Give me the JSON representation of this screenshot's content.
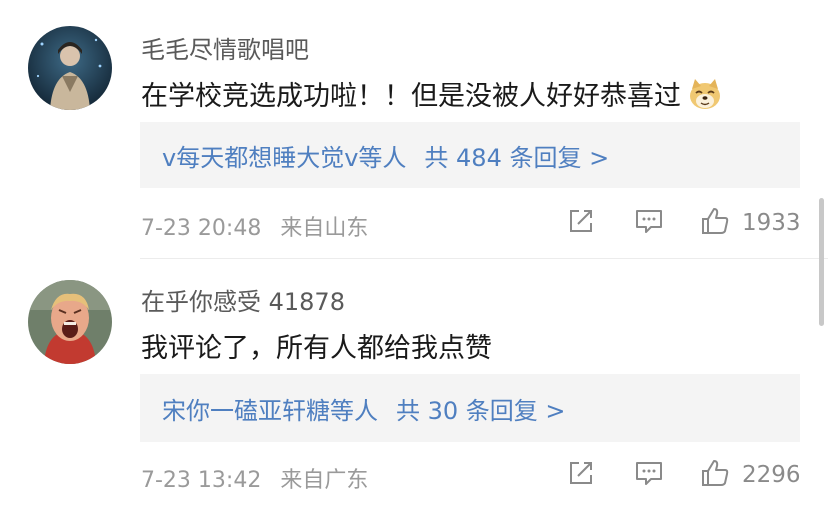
{
  "comments": [
    {
      "username": "毛毛尽情歌唱吧",
      "text": "在学校竞选成功啦！！但是没被人好好恭喜过",
      "emoji": "doge-emoji",
      "reply": {
        "names": "v每天都想睡大觉v",
        "suffix": "等人",
        "total": "共 484 条回复 >"
      },
      "time": "7-23 20:48",
      "location": "来自山东",
      "likes": "1933"
    },
    {
      "username": "在乎你感受 41878",
      "text": "我评论了，所有人都给我点赞",
      "reply": {
        "names": "宋你一磕亚轩糖",
        "suffix": "等人",
        "total": "共 30 条回复 >"
      },
      "time": "7-23 13:42",
      "location": "来自广东",
      "likes": "2296"
    }
  ],
  "colors": {
    "link": "#4f7fc0",
    "meta": "#9a9a9a",
    "reply_bg": "#f4f4f4"
  }
}
